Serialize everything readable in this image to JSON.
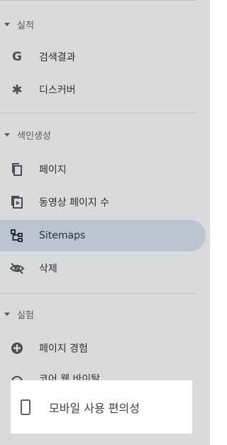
{
  "sections": {
    "performance": {
      "label": "실적"
    },
    "indexing": {
      "label": "색인생성"
    },
    "experience": {
      "label": "실험"
    }
  },
  "items": {
    "search_results": {
      "label": "검색결과",
      "icon": "google-g-icon"
    },
    "discover": {
      "label": "디스커버",
      "icon": "asterisk-icon"
    },
    "pages": {
      "label": "페이지",
      "icon": "pages-copy-icon"
    },
    "video_pages": {
      "label": "동영상 페이지 수",
      "icon": "video-page-icon"
    },
    "sitemaps": {
      "label": "Sitemaps",
      "icon": "sitemap-icon"
    },
    "removals": {
      "label": "삭제",
      "icon": "eye-off-icon"
    },
    "page_experience": {
      "label": "페이지 경험",
      "icon": "plus-circle-icon"
    },
    "core_web_vitals": {
      "label": "코어 웹 바이탈",
      "icon": "gauge-icon"
    }
  },
  "tooltip": {
    "label": "모바일 사용 편의성",
    "icon": "mobile-phone-icon"
  },
  "colors": {
    "background": "#d9dadc",
    "active_bg": "#b9c3d2",
    "tooltip_bg": "#ffffff"
  }
}
